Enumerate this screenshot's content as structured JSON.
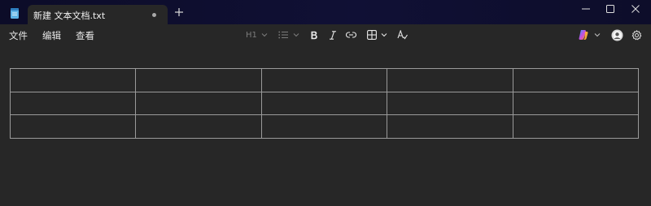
{
  "window": {
    "tab_title": "新建 文本文档.txt",
    "tab_modified": true
  },
  "menu": {
    "file": "文件",
    "edit": "编辑",
    "view": "查看"
  },
  "toolbar": {
    "heading_level": "H1",
    "icons": [
      "heading-dropdown",
      "list-icon",
      "bold-icon",
      "italic-icon",
      "link-icon",
      "table-icon",
      "clear-format-icon",
      "copilot-icon",
      "profile-avatar",
      "settings-gear-icon"
    ]
  },
  "document": {
    "table": {
      "rows": 3,
      "columns": 5,
      "cells": [
        [
          "",
          "",
          "",
          "",
          ""
        ],
        [
          "",
          "",
          "",
          "",
          ""
        ],
        [
          "",
          "",
          "",
          "",
          ""
        ]
      ]
    }
  },
  "colors": {
    "titlebar": "#0e0e2e",
    "editor_bg": "#272727",
    "table_border": "#9a9a9a",
    "text": "#e6e6e6"
  }
}
